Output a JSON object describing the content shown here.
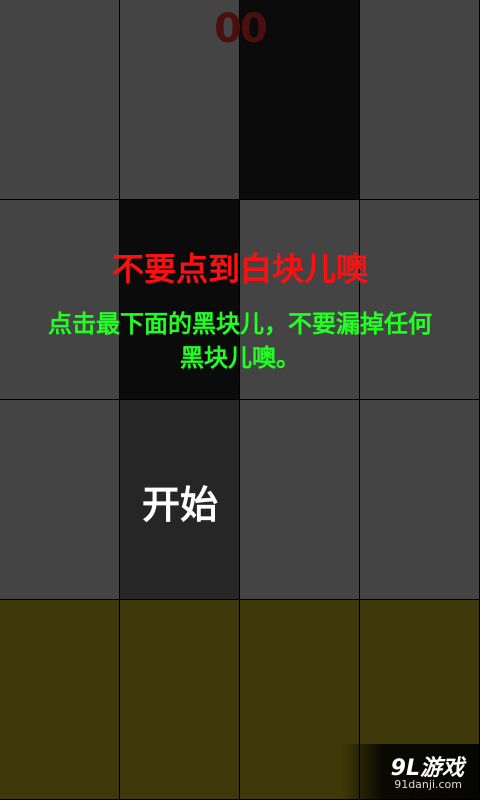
{
  "score": "00",
  "hint_title": "不要点到白块儿噢",
  "hint_line1": "点击最下面的黑块儿，不要漏掉任何",
  "hint_line2": "黑块儿噢。",
  "start_label": "开始",
  "watermark": {
    "brand": "9L游戏",
    "url": "91danji.com"
  },
  "colors": {
    "gray_tile": "#444444",
    "black_tile": "#0b0b0b",
    "start_tile": "#262626",
    "olive_tile": "#3f3808",
    "score": "#4a0f0f",
    "hint_title": "#ff1010",
    "hint_body": "#22ff22"
  },
  "grid": {
    "rows": [
      [
        "gray",
        "gray",
        "black",
        "gray"
      ],
      [
        "gray",
        "black",
        "gray",
        "gray"
      ],
      [
        "gray",
        "start",
        "gray",
        "gray"
      ],
      [
        "olive",
        "olive",
        "olive",
        "olive"
      ]
    ]
  }
}
